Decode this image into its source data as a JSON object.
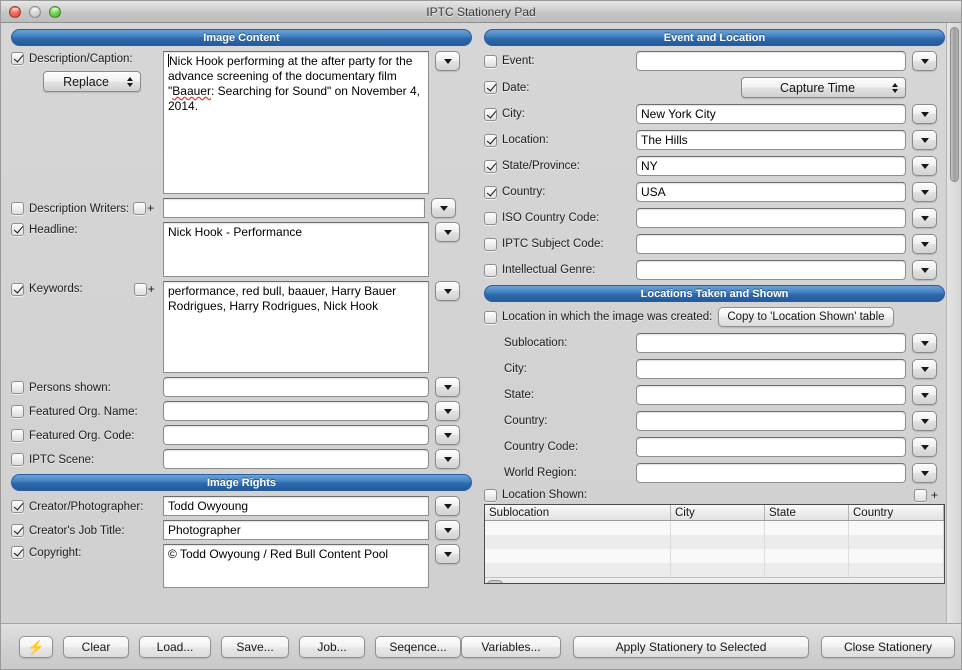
{
  "window": {
    "title": "IPTC Stationery Pad",
    "traffic_lights": [
      "close-button",
      "minimize-button",
      "zoom-button"
    ]
  },
  "left": {
    "image_content": {
      "header": "Image Content",
      "description": {
        "label": "Description/Caption:",
        "checked": true,
        "mode_button": "Replace",
        "value_pre": "Nick Hook performing at the after party for the advance screening of the documentary film \"",
        "value_misspelled": "Baauer",
        "value_post": ": Searching for Sound\" on November 4, 2014."
      },
      "description_writers": {
        "label": "Description Writers:",
        "checked": false,
        "extra_checked": false,
        "plus": "+",
        "value": ""
      },
      "headline": {
        "label": "Headline:",
        "checked": true,
        "value": "Nick Hook - Performance"
      },
      "keywords": {
        "label": "Keywords:",
        "checked": true,
        "extra_checked": false,
        "plus": "+",
        "value": "performance, red bull, baauer, Harry Bauer Rodrigues, Harry Rodrigues, Nick Hook"
      },
      "persons_shown": {
        "label": "Persons shown:",
        "checked": false,
        "value": ""
      },
      "featured_org_name": {
        "label": "Featured Org. Name:",
        "checked": false,
        "value": ""
      },
      "featured_org_code": {
        "label": "Featured Org. Code:",
        "checked": false,
        "value": ""
      },
      "iptc_scene": {
        "label": "IPTC Scene:",
        "checked": false,
        "value": ""
      }
    },
    "image_rights": {
      "header": "Image Rights",
      "creator": {
        "label": "Creator/Photographer:",
        "checked": true,
        "value": "Todd Owyoung"
      },
      "job_title": {
        "label": "Creator's Job Title:",
        "checked": true,
        "value": "Photographer"
      },
      "copyright": {
        "label": "Copyright:",
        "checked": true,
        "value": "© Todd Owyoung / Red Bull Content Pool"
      }
    }
  },
  "right": {
    "event_location": {
      "header": "Event and Location",
      "event": {
        "label": "Event:",
        "checked": false,
        "value": ""
      },
      "date": {
        "label": "Date:",
        "checked": true,
        "popup_value": "Capture Time"
      },
      "city": {
        "label": "City:",
        "checked": true,
        "value": "New York City"
      },
      "location": {
        "label": "Location:",
        "checked": true,
        "value": "The Hills"
      },
      "state_province": {
        "label": "State/Province:",
        "checked": true,
        "value": "NY"
      },
      "country": {
        "label": "Country:",
        "checked": true,
        "value": "USA"
      },
      "iso_country_code": {
        "label": "ISO Country Code:",
        "checked": false,
        "value": ""
      },
      "iptc_subject_code": {
        "label": "IPTC Subject Code:",
        "checked": false,
        "value": ""
      },
      "intellectual_genre": {
        "label": "Intellectual Genre:",
        "checked": false,
        "value": ""
      }
    },
    "locations": {
      "header": "Locations Taken and Shown",
      "created_row": {
        "label": "Location in which the image was created:",
        "checked": false,
        "copy_button": "Copy to 'Location Shown' table"
      },
      "fields": [
        {
          "label": "Sublocation:",
          "value": ""
        },
        {
          "label": "City:",
          "value": ""
        },
        {
          "label": "State:",
          "value": ""
        },
        {
          "label": "Country:",
          "value": ""
        },
        {
          "label": "Country Code:",
          "value": ""
        },
        {
          "label": "World Region:",
          "value": ""
        }
      ],
      "location_shown": {
        "label": "Location Shown:",
        "checked": false,
        "extra_checked": false,
        "plus": "+"
      },
      "table": {
        "columns": [
          "Sublocation",
          "City",
          "State",
          "Country"
        ],
        "rows": [
          [
            "",
            "",
            "",
            ""
          ],
          [
            "",
            "",
            "",
            ""
          ],
          [
            "",
            "",
            "",
            ""
          ],
          [
            "",
            "",
            "",
            ""
          ]
        ]
      }
    }
  },
  "toolbar": {
    "bolt_icon": "⚡",
    "clear": "Clear",
    "load": "Load...",
    "save": "Save...",
    "job": "Job...",
    "sequence": "Seqence...",
    "variables": "Variables...",
    "apply": "Apply Stationery to Selected",
    "close": "Close Stationery"
  },
  "colors": {
    "section_header_blue": "#2f6cae",
    "window_bg": "#d4d4d4",
    "field_white": "#ffffff",
    "spellcheck_red": "#e03b2f"
  }
}
